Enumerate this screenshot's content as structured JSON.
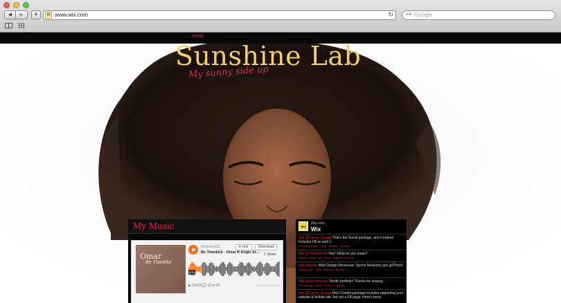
{
  "browser": {
    "url": "www.wix.com",
    "search_placeholder": "Google"
  },
  "site": {
    "nav_home": "HOME",
    "title": "Sunshine Lab",
    "tagline": "My sunny side up"
  },
  "music": {
    "header": "My Music",
    "user": "Soulman321",
    "track": "Be Thankful - Omar ft Angie St...",
    "like_label": "Like",
    "download_label": "Download",
    "share_label": "Share",
    "artwork_title": "Omar",
    "artwork_subtitle": "Be Thankful",
    "time": "0:15",
    "stats": "▶ 28658   💬 10   ♥ 19",
    "brand": "SOUNDCLOUD"
  },
  "social": {
    "url": "Wix.com",
    "name": "Wix",
    "posts": [
      {
        "handle": "Wix @Carlos_Zuniga",
        "text": " That's the Social package, and it indeed includes FB as well :)",
        "meta": "28 seconds ago · reply · retweet · favorite"
      },
      {
        "handle": "Wix @Thewrite99k",
        "text": " Hey! What do you mean?",
        "meta": "about 1 minute ago · reply · retweet · favorite"
      },
      {
        "handle": "Wix #Mobile",
        "text": " Web Design Showcase: Sports Networks goo.gl/7HdzIt",
        "meta": "5 hours ago · reply · retweet · favorite"
      },
      {
        "handle": "Wix @sandsdsweb",
        "text": " Terrific portfolio! Thanks for sharing",
        "meta": "6 hours ago · reply · retweet · favorite"
      },
      {
        "handle": "Wix @Carlos_Zuniga",
        "text": " Hey! Combo package includes upgrading your website & mobile site, but not a FB page. Here's more",
        "meta": ""
      }
    ]
  },
  "colors": {
    "accent_red": "#e8273b",
    "title_gold": "#f0cf6b",
    "soundcloud_orange": "#f5701e"
  }
}
